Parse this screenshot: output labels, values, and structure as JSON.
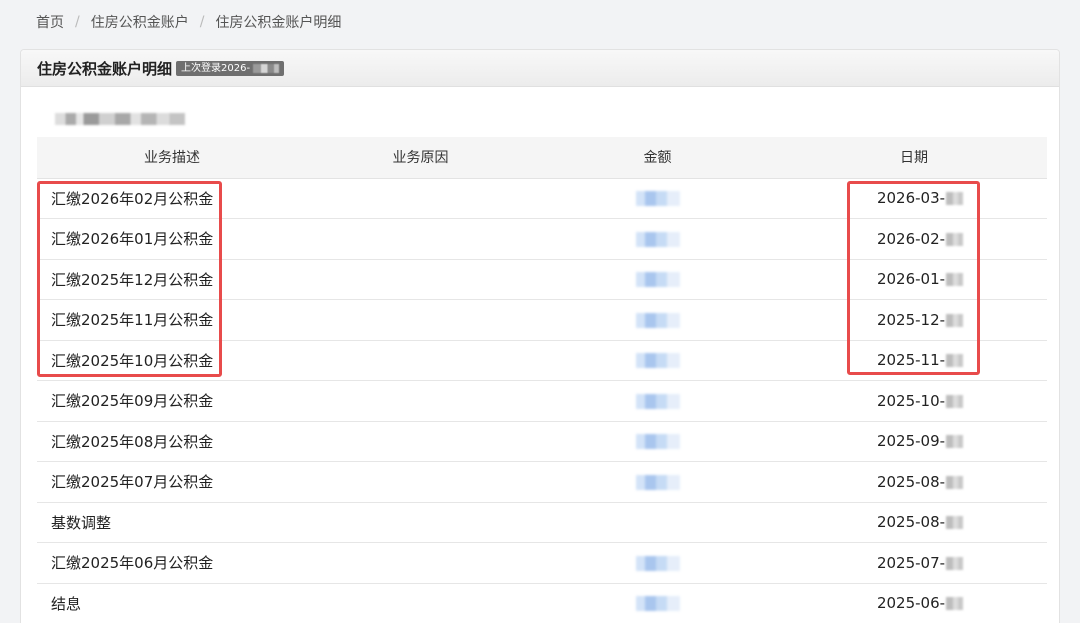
{
  "breadcrumb": {
    "items": [
      "首页",
      "住房公积金账户",
      "住房公积金账户明细"
    ],
    "separator": "/"
  },
  "panel": {
    "title": "住房公积金账户明细",
    "last_login_prefix": "上次登录2026-"
  },
  "table": {
    "headers": [
      "业务描述",
      "业务原因",
      "金额",
      "日期"
    ],
    "rows": [
      {
        "description": "汇缴2026年02月公积金",
        "reason": "",
        "amount_masked": true,
        "date_prefix": "2026-03-"
      },
      {
        "description": "汇缴2026年01月公积金",
        "reason": "",
        "amount_masked": true,
        "date_prefix": "2026-02-"
      },
      {
        "description": "汇缴2025年12月公积金",
        "reason": "",
        "amount_masked": true,
        "date_prefix": "2026-01-"
      },
      {
        "description": "汇缴2025年11月公积金",
        "reason": "",
        "amount_masked": true,
        "date_prefix": "2025-12-"
      },
      {
        "description": "汇缴2025年10月公积金",
        "reason": "",
        "amount_masked": true,
        "date_prefix": "2025-11-"
      },
      {
        "description": "汇缴2025年09月公积金",
        "reason": "",
        "amount_masked": true,
        "date_prefix": "2025-10-"
      },
      {
        "description": "汇缴2025年08月公积金",
        "reason": "",
        "amount_masked": true,
        "date_prefix": "2025-09-"
      },
      {
        "description": "汇缴2025年07月公积金",
        "reason": "",
        "amount_masked": true,
        "date_prefix": "2025-08-"
      },
      {
        "description": "基数调整",
        "reason": "",
        "amount_masked": false,
        "date_prefix": "2025-08-"
      },
      {
        "description": "汇缴2025年06月公积金",
        "reason": "",
        "amount_masked": true,
        "date_prefix": "2025-07-"
      },
      {
        "description": "结息",
        "reason": "",
        "amount_masked": true,
        "date_prefix": "2025-06-"
      }
    ]
  },
  "colors": {
    "highlight_border": "#e84b4b",
    "header_bg": "#f5f5f5",
    "page_bg": "#f2f3f5"
  }
}
